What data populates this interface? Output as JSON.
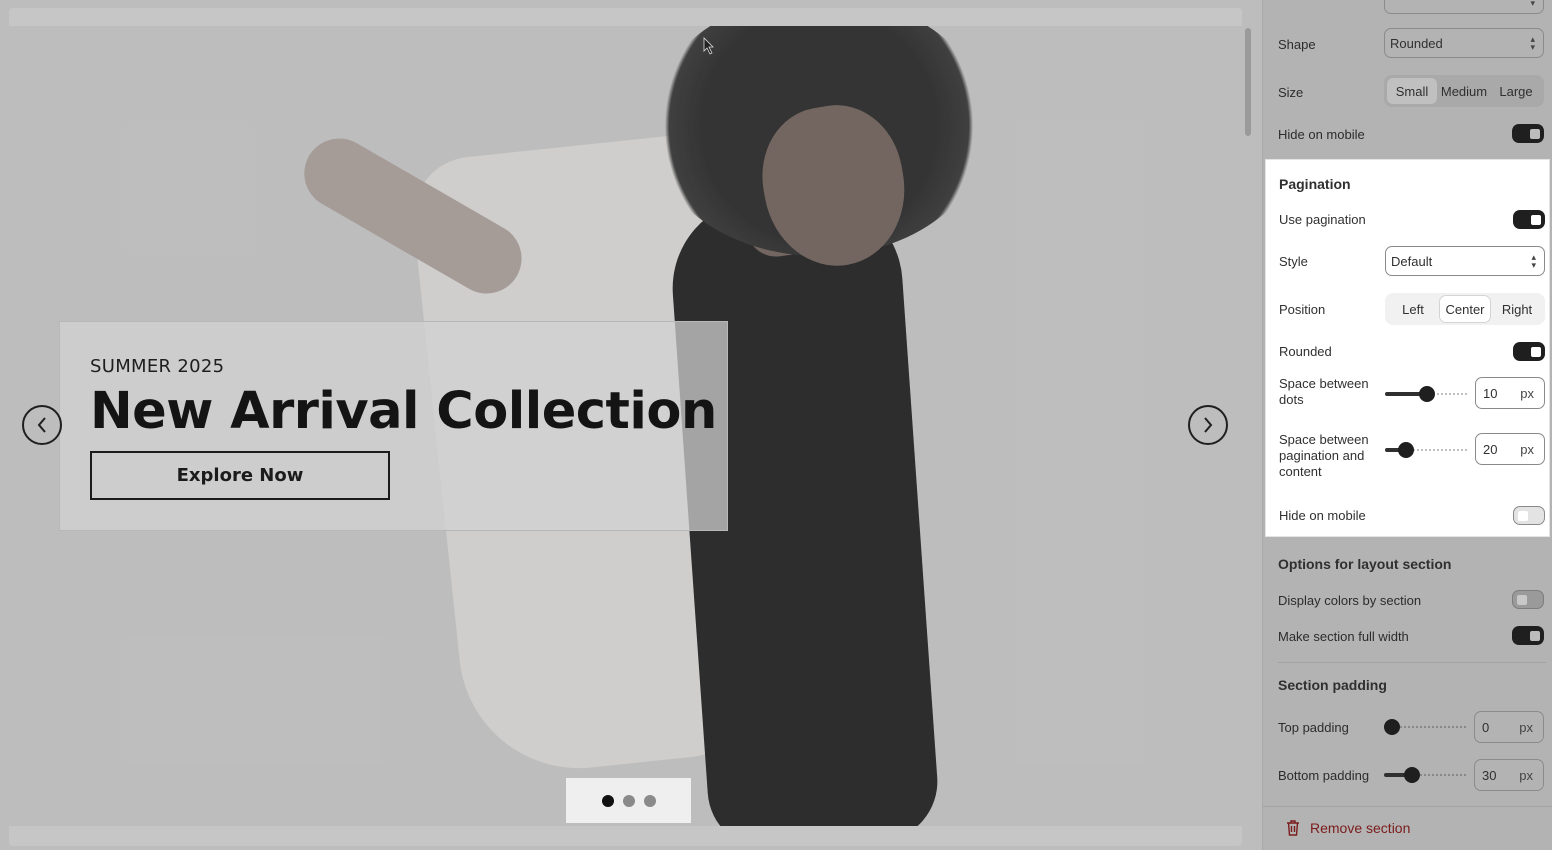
{
  "preview": {
    "banner": {
      "subtitle": "SUMMER 2025",
      "title": "New Arrival Collection",
      "button_label": "Explore Now"
    },
    "pagination_dots": {
      "count": 3,
      "active_index": 0
    }
  },
  "panel": {
    "top": {
      "shape_label": "Shape",
      "shape_value": "Rounded",
      "size_label": "Size",
      "size_options": [
        "Small",
        "Medium",
        "Large"
      ],
      "size_selected": "Small",
      "hide_mobile_label": "Hide on mobile",
      "hide_mobile_on": true
    },
    "pagination": {
      "heading": "Pagination",
      "use_label": "Use pagination",
      "use_on": true,
      "style_label": "Style",
      "style_value": "Default",
      "position_label": "Position",
      "position_options": [
        "Left",
        "Center",
        "Right"
      ],
      "position_selected": "Center",
      "rounded_label": "Rounded",
      "rounded_on": true,
      "dots_space_label": "Space between dots",
      "dots_space_value": "10",
      "content_space_label": "Space between pagination and content",
      "content_space_value": "20",
      "unit": "px",
      "hide_mobile_label": "Hide on mobile",
      "hide_mobile_on": false
    },
    "layout": {
      "heading": "Options for layout section",
      "colors_label": "Display colors by section",
      "colors_on": false,
      "full_width_label": "Make section full width",
      "full_width_on": true
    },
    "padding": {
      "heading": "Section padding",
      "top_label": "Top padding",
      "top_value": "0",
      "bottom_label": "Bottom padding",
      "bottom_value": "30",
      "unit": "px"
    },
    "remove_label": "Remove section"
  }
}
